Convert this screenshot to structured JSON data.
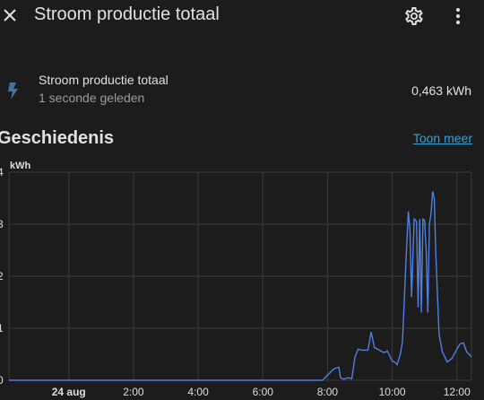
{
  "header": {
    "title": "Stroom productie totaal",
    "close_icon": "close-icon",
    "settings_icon": "gear-icon",
    "menu_icon": "dots-vertical-icon"
  },
  "entity": {
    "icon": "flash-icon",
    "icon_color": "#44739e",
    "name": "Stroom productie totaal",
    "last_changed": "1 seconde geleden",
    "state": "0,463 kWh"
  },
  "history": {
    "title": "Geschiedenis",
    "show_more": "Toon meer",
    "show_more_color": "#3aa0d8"
  },
  "chart_data": {
    "type": "line",
    "ylabel": "kWh",
    "y_tick_labels": [
      "4",
      "3",
      "2",
      "1",
      "0"
    ],
    "x_tick_labels": [
      "24 aug",
      "2:00",
      "4:00",
      "6:00",
      "8:00",
      "10:00",
      "12:00"
    ],
    "xlim_hours": [
      -1.85,
      12.45
    ],
    "ylim": [
      0,
      4
    ],
    "grid": true,
    "line_color": "#4f7fe0",
    "series": [
      {
        "x": [
          -1.85,
          7.85,
          7.97,
          8.2,
          8.35,
          8.4,
          8.5,
          8.65,
          8.75,
          8.85,
          8.95,
          9.05,
          9.15,
          9.25,
          9.35,
          9.45,
          9.6,
          9.75,
          9.85,
          10.0,
          10.1,
          10.15,
          10.2,
          10.25,
          10.32,
          10.42,
          10.5,
          10.55,
          10.6,
          10.68,
          10.75,
          10.8,
          10.85,
          10.9,
          10.95,
          11.0,
          11.05,
          11.1,
          11.15,
          11.2,
          11.25,
          11.3,
          11.35,
          11.45,
          11.55,
          11.7,
          11.85,
          12.0,
          12.1,
          12.2,
          12.3,
          12.45
        ],
        "y": [
          0.0,
          0.0,
          0.08,
          0.22,
          0.25,
          0.05,
          0.02,
          0.05,
          0.03,
          0.45,
          0.6,
          0.58,
          0.58,
          0.58,
          0.93,
          0.63,
          0.58,
          0.53,
          0.56,
          0.37,
          0.34,
          0.3,
          0.4,
          0.5,
          0.75,
          2.2,
          3.25,
          2.9,
          1.6,
          3.1,
          3.05,
          1.4,
          3.1,
          1.3,
          3.1,
          3.07,
          2.5,
          1.3,
          3.0,
          3.2,
          3.63,
          3.5,
          2.4,
          0.88,
          0.55,
          0.35,
          0.42,
          0.6,
          0.7,
          0.72,
          0.55,
          0.45
        ]
      }
    ]
  }
}
